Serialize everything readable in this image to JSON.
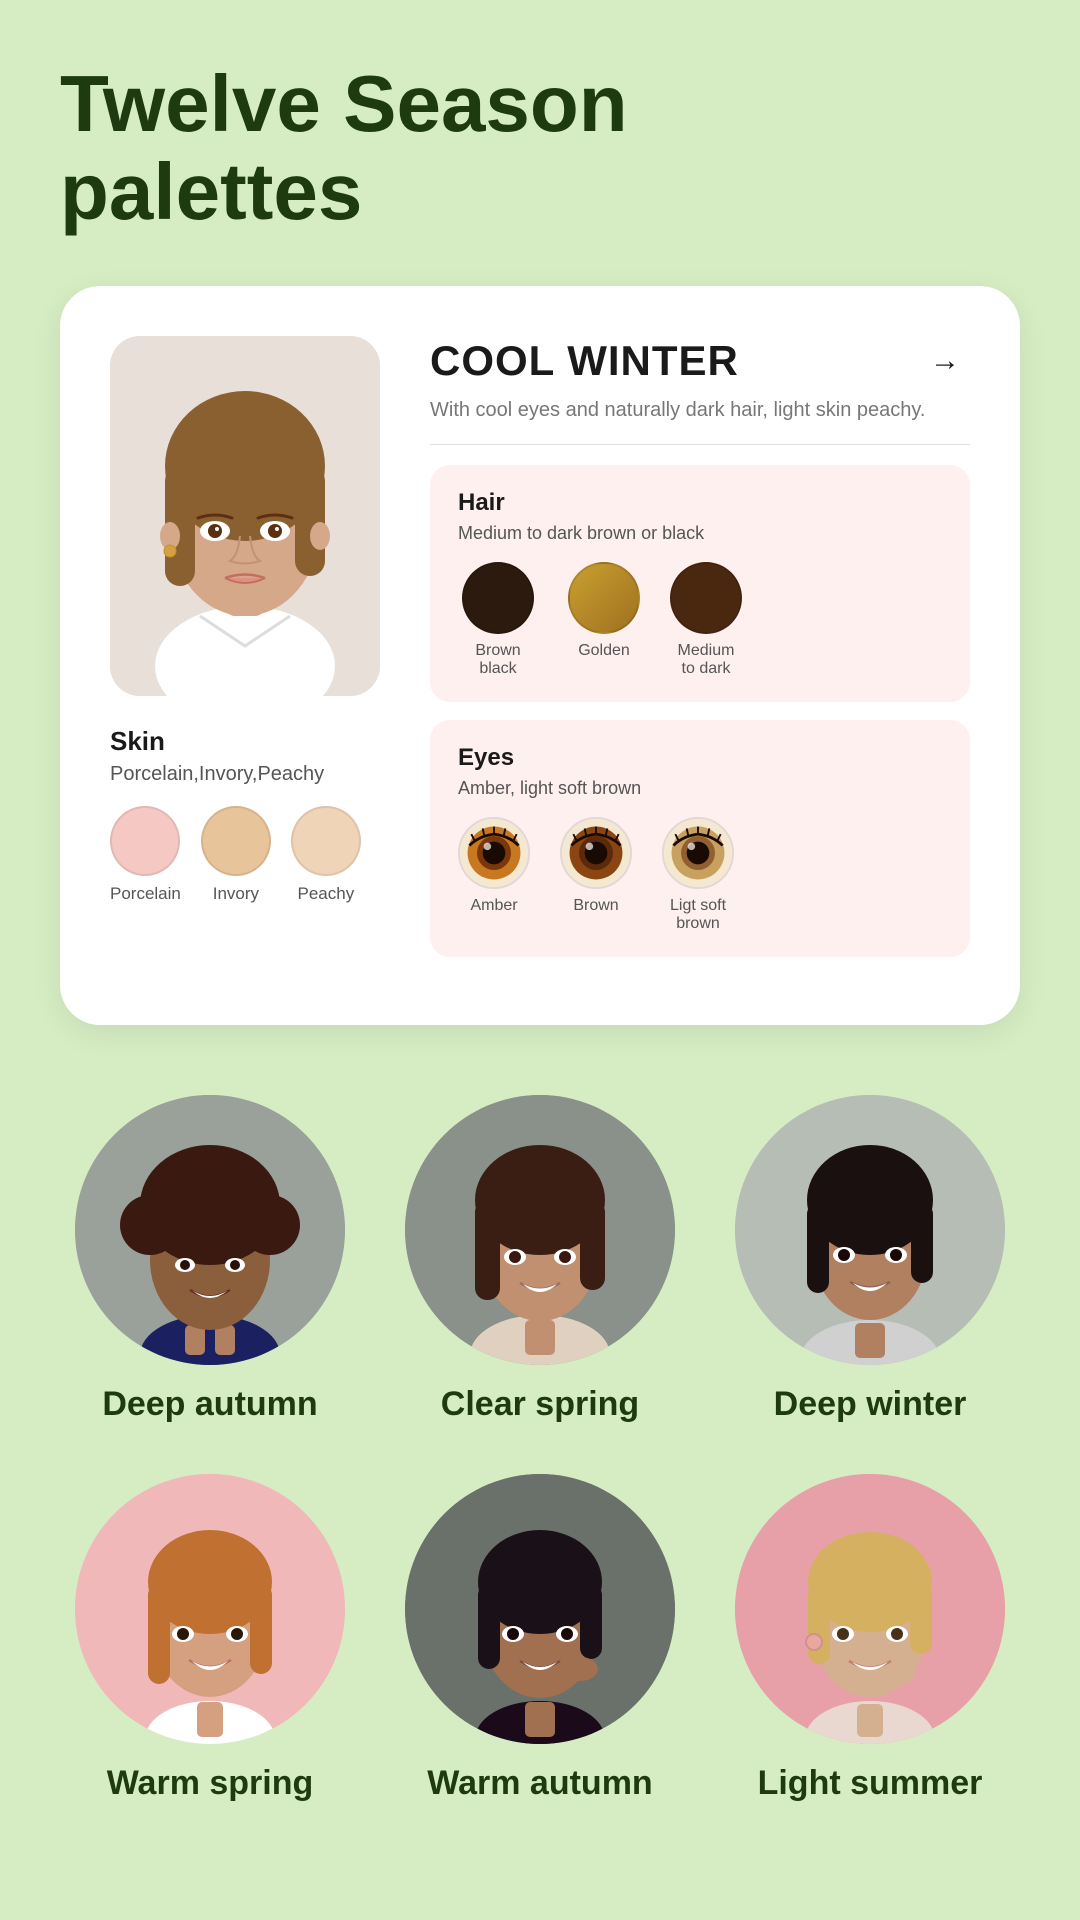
{
  "title": "Twelve Season\npalettes",
  "card": {
    "season": "COOL WINTER",
    "description": "With cool eyes and naturally dark hair, light skin peachy.",
    "arrow": "→",
    "skin": {
      "label": "Skin",
      "subtitle": "Porcelain,Invory,Peachy",
      "swatches": [
        {
          "color": "#f5c8c4",
          "label": "Porcelain"
        },
        {
          "color": "#e8c49a",
          "label": "Invory"
        },
        {
          "color": "#f0d4b8",
          "label": "Peachy"
        }
      ]
    },
    "hair": {
      "title": "Hair",
      "subtitle": "Medium to dark brown or black",
      "swatches": [
        {
          "color": "#2c1a0e",
          "label": "Brown black"
        },
        {
          "color": "#b8922a",
          "label": "Golden"
        },
        {
          "color": "#4a2810",
          "label": "Medium\nto dark"
        }
      ]
    },
    "eyes": {
      "title": "Eyes",
      "subtitle": "Amber, light soft brown",
      "swatches": [
        {
          "color": "#8B4513",
          "label": "Amber",
          "inner": "#c8722a"
        },
        {
          "color": "#5c3010",
          "label": "Brown",
          "inner": "#8B4513"
        },
        {
          "color": "#a07040",
          "label": "Ligt soft\nbrown",
          "inner": "#c8a060"
        }
      ]
    }
  },
  "people": [
    {
      "name": "Deep autumn",
      "bg": "bg-gray",
      "skin": "#8B6050",
      "hair": "#3a1a10"
    },
    {
      "name": "Clear spring",
      "bg": "bg-medium-gray",
      "skin": "#c09070",
      "hair": "#3a1e14"
    },
    {
      "name": "Deep winter",
      "bg": "bg-light-gray",
      "skin": "#b08060",
      "hair": "#1a1010"
    },
    {
      "name": "Warm spring",
      "bg": "bg-pink",
      "skin": "#d4a080",
      "hair": "#c07030"
    },
    {
      "name": "Warm autumn",
      "bg": "bg-dark-gray",
      "skin": "#a07050",
      "hair": "#1a1018"
    },
    {
      "name": "Light summer",
      "bg": "bg-rose",
      "skin": "#d4b090",
      "hair": "#d4b060"
    }
  ]
}
